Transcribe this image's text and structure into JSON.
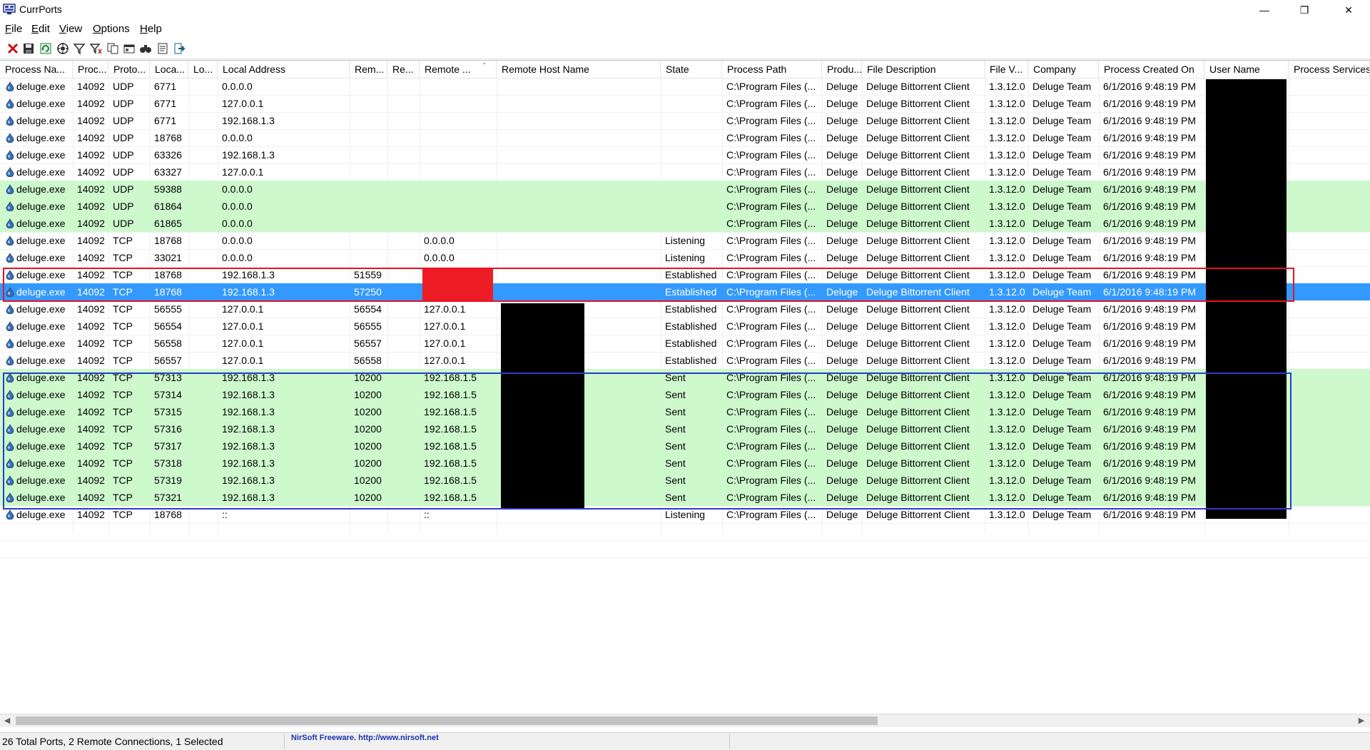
{
  "window": {
    "title": "CurrPorts",
    "minimize": "—",
    "restore": "❐",
    "close": "✕"
  },
  "menu": [
    {
      "u": "F",
      "rest": "ile"
    },
    {
      "u": "E",
      "rest": "dit"
    },
    {
      "u": "V",
      "rest": "iew"
    },
    {
      "u": "O",
      "rest": "ptions"
    },
    {
      "u": "H",
      "rest": "elp"
    }
  ],
  "toolbar": [
    "close-connection-icon",
    "save-icon",
    "refresh-icon",
    "properties-icon",
    "filter-icon",
    "advanced-filter-icon",
    "copy-icon",
    "html-report-icon",
    "find-icon",
    "report-icon",
    "exit-icon"
  ],
  "columns": [
    {
      "label": "Process Na..."
    },
    {
      "label": "Proc..."
    },
    {
      "label": "Proto..."
    },
    {
      "label": "Loca..."
    },
    {
      "label": "Lo..."
    },
    {
      "label": "Local Address"
    },
    {
      "label": "Rem..."
    },
    {
      "label": "Re..."
    },
    {
      "label": "Remote ..."
    },
    {
      "label": "Remote Host Name"
    },
    {
      "label": "State"
    },
    {
      "label": "Process Path"
    },
    {
      "label": "Produ..."
    },
    {
      "label": "File Description"
    },
    {
      "label": "File V..."
    },
    {
      "label": "Company"
    },
    {
      "label": "Process Created On"
    },
    {
      "label": "User Name"
    },
    {
      "label": "Process Services"
    }
  ],
  "sort_indicator": "ˆ",
  "rows": [
    {
      "style": "white",
      "c": [
        "deluge.exe",
        "14092",
        "UDP",
        "6771",
        "",
        "0.0.0.0",
        "",
        "",
        "",
        "",
        "",
        "C:\\Program Files (...",
        "Deluge",
        "Deluge Bittorrent Client",
        "1.3.12.0",
        "Deluge Team",
        "6/1/2016 9:48:19 PM",
        "",
        ""
      ]
    },
    {
      "style": "white",
      "c": [
        "deluge.exe",
        "14092",
        "UDP",
        "6771",
        "",
        "127.0.0.1",
        "",
        "",
        "",
        "",
        "",
        "C:\\Program Files (...",
        "Deluge",
        "Deluge Bittorrent Client",
        "1.3.12.0",
        "Deluge Team",
        "6/1/2016 9:48:19 PM",
        "",
        ""
      ]
    },
    {
      "style": "white",
      "c": [
        "deluge.exe",
        "14092",
        "UDP",
        "6771",
        "",
        "192.168.1.3",
        "",
        "",
        "",
        "",
        "",
        "C:\\Program Files (...",
        "Deluge",
        "Deluge Bittorrent Client",
        "1.3.12.0",
        "Deluge Team",
        "6/1/2016 9:48:19 PM",
        "",
        ""
      ]
    },
    {
      "style": "white",
      "c": [
        "deluge.exe",
        "14092",
        "UDP",
        "18768",
        "",
        "0.0.0.0",
        "",
        "",
        "",
        "",
        "",
        "C:\\Program Files (...",
        "Deluge",
        "Deluge Bittorrent Client",
        "1.3.12.0",
        "Deluge Team",
        "6/1/2016 9:48:19 PM",
        "",
        ""
      ]
    },
    {
      "style": "white",
      "c": [
        "deluge.exe",
        "14092",
        "UDP",
        "63326",
        "",
        "192.168.1.3",
        "",
        "",
        "",
        "",
        "",
        "C:\\Program Files (...",
        "Deluge",
        "Deluge Bittorrent Client",
        "1.3.12.0",
        "Deluge Team",
        "6/1/2016 9:48:19 PM",
        "",
        ""
      ]
    },
    {
      "style": "white",
      "c": [
        "deluge.exe",
        "14092",
        "UDP",
        "63327",
        "",
        "127.0.0.1",
        "",
        "",
        "",
        "",
        "",
        "C:\\Program Files (...",
        "Deluge",
        "Deluge Bittorrent Client",
        "1.3.12.0",
        "Deluge Team",
        "6/1/2016 9:48:19 PM",
        "",
        ""
      ]
    },
    {
      "style": "green",
      "c": [
        "deluge.exe",
        "14092",
        "UDP",
        "59388",
        "",
        "0.0.0.0",
        "",
        "",
        "",
        "",
        "",
        "C:\\Program Files (...",
        "Deluge",
        "Deluge Bittorrent Client",
        "1.3.12.0",
        "Deluge Team",
        "6/1/2016 9:48:19 PM",
        "",
        ""
      ]
    },
    {
      "style": "green",
      "c": [
        "deluge.exe",
        "14092",
        "UDP",
        "61864",
        "",
        "0.0.0.0",
        "",
        "",
        "",
        "",
        "",
        "C:\\Program Files (...",
        "Deluge",
        "Deluge Bittorrent Client",
        "1.3.12.0",
        "Deluge Team",
        "6/1/2016 9:48:19 PM",
        "",
        ""
      ]
    },
    {
      "style": "green",
      "c": [
        "deluge.exe",
        "14092",
        "UDP",
        "61865",
        "",
        "0.0.0.0",
        "",
        "",
        "",
        "",
        "",
        "C:\\Program Files (...",
        "Deluge",
        "Deluge Bittorrent Client",
        "1.3.12.0",
        "Deluge Team",
        "6/1/2016 9:48:19 PM",
        "",
        ""
      ]
    },
    {
      "style": "white",
      "c": [
        "deluge.exe",
        "14092",
        "TCP",
        "18768",
        "",
        "0.0.0.0",
        "",
        "",
        "0.0.0.0",
        "",
        "Listening",
        "C:\\Program Files (...",
        "Deluge",
        "Deluge Bittorrent Client",
        "1.3.12.0",
        "Deluge Team",
        "6/1/2016 9:48:19 PM",
        "",
        ""
      ]
    },
    {
      "style": "white",
      "c": [
        "deluge.exe",
        "14092",
        "TCP",
        "33021",
        "",
        "0.0.0.0",
        "",
        "",
        "0.0.0.0",
        "",
        "Listening",
        "C:\\Program Files (...",
        "Deluge",
        "Deluge Bittorrent Client",
        "1.3.12.0",
        "Deluge Team",
        "6/1/2016 9:48:19 PM",
        "",
        ""
      ]
    },
    {
      "style": "white",
      "c": [
        "deluge.exe",
        "14092",
        "TCP",
        "18768",
        "",
        "192.168.1.3",
        "51559",
        "",
        "",
        "",
        "Established",
        "C:\\Program Files (...",
        "Deluge",
        "Deluge Bittorrent Client",
        "1.3.12.0",
        "Deluge Team",
        "6/1/2016 9:48:19 PM",
        "",
        ""
      ]
    },
    {
      "style": "sel",
      "c": [
        "deluge.exe",
        "14092",
        "TCP",
        "18768",
        "",
        "192.168.1.3",
        "57250",
        "",
        "",
        "",
        "Established",
        "C:\\Program Files (...",
        "Deluge",
        "Deluge Bittorrent Client",
        "1.3.12.0",
        "Deluge Team",
        "6/1/2016 9:48:19 PM",
        "",
        ""
      ]
    },
    {
      "style": "white",
      "c": [
        "deluge.exe",
        "14092",
        "TCP",
        "56555",
        "",
        "127.0.0.1",
        "56554",
        "",
        "127.0.0.1",
        "",
        "Established",
        "C:\\Program Files (...",
        "Deluge",
        "Deluge Bittorrent Client",
        "1.3.12.0",
        "Deluge Team",
        "6/1/2016 9:48:19 PM",
        "",
        ""
      ]
    },
    {
      "style": "white",
      "c": [
        "deluge.exe",
        "14092",
        "TCP",
        "56554",
        "",
        "127.0.0.1",
        "56555",
        "",
        "127.0.0.1",
        "",
        "Established",
        "C:\\Program Files (...",
        "Deluge",
        "Deluge Bittorrent Client",
        "1.3.12.0",
        "Deluge Team",
        "6/1/2016 9:48:19 PM",
        "",
        ""
      ]
    },
    {
      "style": "white",
      "c": [
        "deluge.exe",
        "14092",
        "TCP",
        "56558",
        "",
        "127.0.0.1",
        "56557",
        "",
        "127.0.0.1",
        "",
        "Established",
        "C:\\Program Files (...",
        "Deluge",
        "Deluge Bittorrent Client",
        "1.3.12.0",
        "Deluge Team",
        "6/1/2016 9:48:19 PM",
        "",
        ""
      ]
    },
    {
      "style": "white",
      "c": [
        "deluge.exe",
        "14092",
        "TCP",
        "56557",
        "",
        "127.0.0.1",
        "56558",
        "",
        "127.0.0.1",
        "",
        "Established",
        "C:\\Program Files (...",
        "Deluge",
        "Deluge Bittorrent Client",
        "1.3.12.0",
        "Deluge Team",
        "6/1/2016 9:48:19 PM",
        "",
        ""
      ]
    },
    {
      "style": "green",
      "c": [
        "deluge.exe",
        "14092",
        "TCP",
        "57313",
        "",
        "192.168.1.3",
        "10200",
        "",
        "192.168.1.5",
        "",
        "Sent",
        "C:\\Program Files (...",
        "Deluge",
        "Deluge Bittorrent Client",
        "1.3.12.0",
        "Deluge Team",
        "6/1/2016 9:48:19 PM",
        "",
        ""
      ]
    },
    {
      "style": "green",
      "c": [
        "deluge.exe",
        "14092",
        "TCP",
        "57314",
        "",
        "192.168.1.3",
        "10200",
        "",
        "192.168.1.5",
        "",
        "Sent",
        "C:\\Program Files (...",
        "Deluge",
        "Deluge Bittorrent Client",
        "1.3.12.0",
        "Deluge Team",
        "6/1/2016 9:48:19 PM",
        "",
        ""
      ]
    },
    {
      "style": "green",
      "c": [
        "deluge.exe",
        "14092",
        "TCP",
        "57315",
        "",
        "192.168.1.3",
        "10200",
        "",
        "192.168.1.5",
        "",
        "Sent",
        "C:\\Program Files (...",
        "Deluge",
        "Deluge Bittorrent Client",
        "1.3.12.0",
        "Deluge Team",
        "6/1/2016 9:48:19 PM",
        "",
        ""
      ]
    },
    {
      "style": "green",
      "c": [
        "deluge.exe",
        "14092",
        "TCP",
        "57316",
        "",
        "192.168.1.3",
        "10200",
        "",
        "192.168.1.5",
        "",
        "Sent",
        "C:\\Program Files (...",
        "Deluge",
        "Deluge Bittorrent Client",
        "1.3.12.0",
        "Deluge Team",
        "6/1/2016 9:48:19 PM",
        "",
        ""
      ]
    },
    {
      "style": "green",
      "c": [
        "deluge.exe",
        "14092",
        "TCP",
        "57317",
        "",
        "192.168.1.3",
        "10200",
        "",
        "192.168.1.5",
        "",
        "Sent",
        "C:\\Program Files (...",
        "Deluge",
        "Deluge Bittorrent Client",
        "1.3.12.0",
        "Deluge Team",
        "6/1/2016 9:48:19 PM",
        "",
        ""
      ]
    },
    {
      "style": "green",
      "c": [
        "deluge.exe",
        "14092",
        "TCP",
        "57318",
        "",
        "192.168.1.3",
        "10200",
        "",
        "192.168.1.5",
        "",
        "Sent",
        "C:\\Program Files (...",
        "Deluge",
        "Deluge Bittorrent Client",
        "1.3.12.0",
        "Deluge Team",
        "6/1/2016 9:48:19 PM",
        "",
        ""
      ]
    },
    {
      "style": "green",
      "c": [
        "deluge.exe",
        "14092",
        "TCP",
        "57319",
        "",
        "192.168.1.3",
        "10200",
        "",
        "192.168.1.5",
        "",
        "Sent",
        "C:\\Program Files (...",
        "Deluge",
        "Deluge Bittorrent Client",
        "1.3.12.0",
        "Deluge Team",
        "6/1/2016 9:48:19 PM",
        "",
        ""
      ]
    },
    {
      "style": "green",
      "c": [
        "deluge.exe",
        "14092",
        "TCP",
        "57321",
        "",
        "192.168.1.3",
        "10200",
        "",
        "192.168.1.5",
        "",
        "Sent",
        "C:\\Program Files (...",
        "Deluge",
        "Deluge Bittorrent Client",
        "1.3.12.0",
        "Deluge Team",
        "6/1/2016 9:48:19 PM",
        "",
        ""
      ]
    },
    {
      "style": "white",
      "c": [
        "deluge.exe",
        "14092",
        "TCP",
        "18768",
        "",
        "::",
        "",
        "",
        "::",
        "",
        "Listening",
        "C:\\Program Files (...",
        "Deluge",
        "Deluge Bittorrent Client",
        "1.3.12.0",
        "Deluge Team",
        "6/1/2016 9:48:19 PM",
        "",
        ""
      ]
    }
  ],
  "status": {
    "summary": "26 Total Ports, 2 Remote Connections, 1 Selected",
    "credit": "NirSoft Freeware.  http://www.nirsoft.net"
  },
  "colors": {
    "green_row": "#cdf9cd",
    "selection": "#3399ff",
    "red_box": "#e81123",
    "blue_box": "#2b3acb",
    "redact_red": "#ee1c24"
  }
}
